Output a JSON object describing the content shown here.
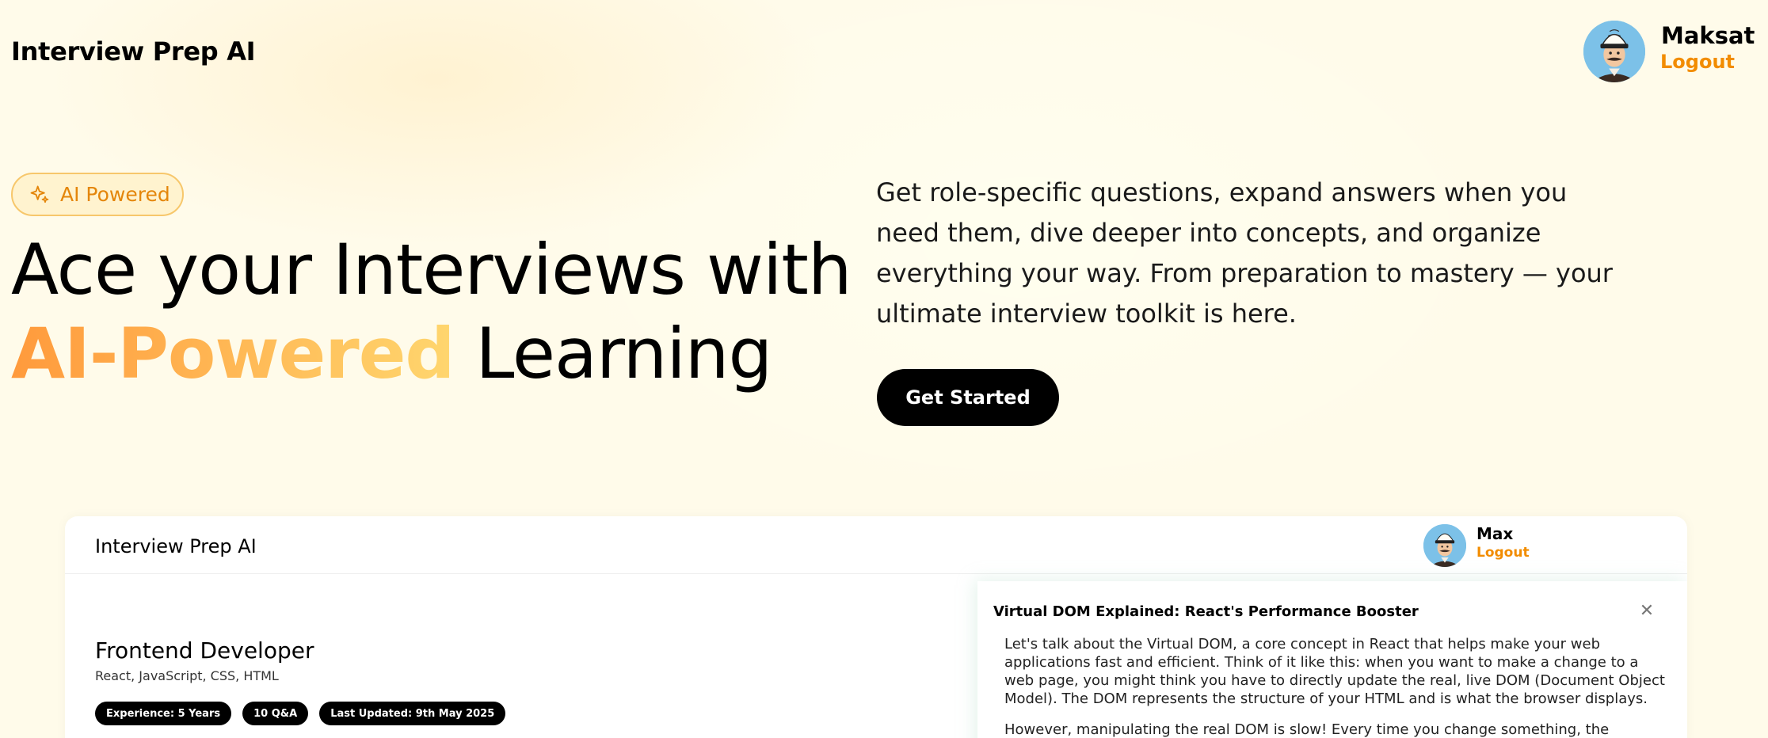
{
  "header": {
    "brand": "Interview Prep AI",
    "user": {
      "name": "Maksat",
      "logout_label": "Logout",
      "avatar_icon": "avatar-kalpak-man-icon"
    }
  },
  "hero": {
    "badge": {
      "icon": "sparkle-icon",
      "label": "AI Powered"
    },
    "title_line1": "Ace your Interviews with",
    "title_highlight": "AI-Powered",
    "title_rest": "Learning",
    "description": "Get role-specific questions, expand answers when you need them, dive deeper into concepts, and organize everything your way. From preparation to mastery — your ultimate interview toolkit is here.",
    "cta_label": "Get Started"
  },
  "preview": {
    "brand": "Interview Prep AI",
    "user": {
      "name": "Max",
      "logout_label": "Logout"
    },
    "session": {
      "role": "Frontend Developer",
      "skills": "React, JavaScript, CSS, HTML",
      "chips": [
        "Experience: 5 Years",
        "10 Q&A",
        "Last Updated: 9th May 2025"
      ]
    },
    "drawer": {
      "title": "Virtual DOM Explained: React's Performance Booster",
      "close_icon": "close-icon",
      "paragraphs": [
        "Let's talk about the Virtual DOM, a core concept in React that helps make your web applications fast and efficient. Think of it like this: when you want to make a change to a web page, you might think you have to directly update the real, live DOM (Document Object Model). The DOM represents the structure of your HTML and is what the browser displays.",
        "However, manipulating the real DOM is slow! Every time you change something, the browser has to"
      ]
    }
  },
  "colors": {
    "accent": "#f28c00",
    "background": "#fffbea",
    "gradient_start": "#ff9a3c",
    "gradient_end": "#ffd66e",
    "button": "#000000"
  }
}
